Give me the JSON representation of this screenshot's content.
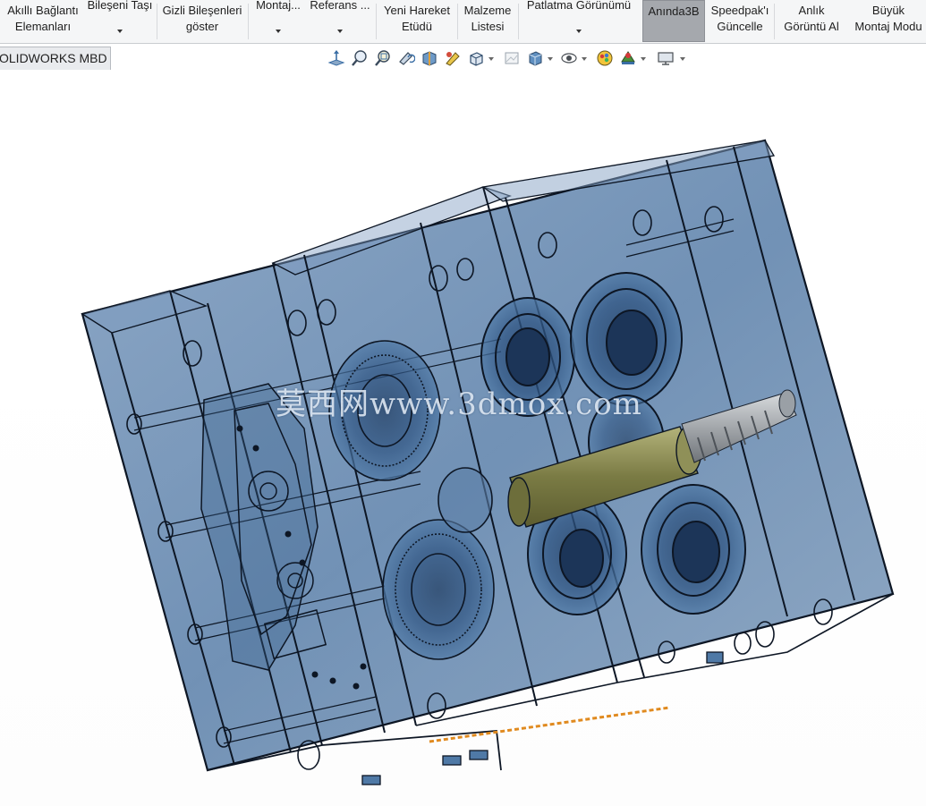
{
  "ribbon": {
    "buttons": [
      {
        "id": "smart-mates",
        "line1": "Akıllı Bağlantı",
        "line2": "Elemanları"
      },
      {
        "id": "move-component",
        "line1": "Bileşeni Taşı",
        "line2": ""
      },
      {
        "id": "show-hidden",
        "line1": "Gizli Bileşenleri",
        "line2": "göster"
      },
      {
        "id": "assembly-features",
        "line1": "Montaj...",
        "line2": ""
      },
      {
        "id": "reference",
        "line1": "Referans ...",
        "line2": ""
      },
      {
        "id": "new-motion-study",
        "line1": "Yeni Hareket",
        "line2": "Etüdü"
      },
      {
        "id": "bill-of-materials",
        "line1": "Malzeme",
        "line2": "Listesi"
      },
      {
        "id": "exploded-view",
        "line1": "Patlatma Görünümü",
        "line2": ""
      },
      {
        "id": "instant3d",
        "line1": "Anında3B",
        "line2": ""
      },
      {
        "id": "speedpak",
        "line1": "Speedpak'ı",
        "line2": "Güncelle"
      },
      {
        "id": "snapshot",
        "line1": "Anlık",
        "line2": "Görüntü Al"
      },
      {
        "id": "large-assembly",
        "line1": "Büyük",
        "line2": "Montaj Modu"
      }
    ]
  },
  "tabs": {
    "mbd_label": "OLIDWORKS MBD"
  },
  "hud_icons": [
    "view-normal-to-icon",
    "zoom-to-fit-icon",
    "zoom-to-area-icon",
    "previous-view-icon",
    "section-view-icon",
    "dynamic-annotation-icon",
    "view-orientation-icon",
    "display-style-icon",
    "hide-show-items-icon",
    "edit-appearance-icon",
    "apply-scene-icon",
    "view-settings-icon",
    "display-pane-icon"
  ],
  "graphics": {
    "watermark": "莫西网www.3dmox.com",
    "colors": {
      "housing_fill": "#4f79a6",
      "housing_edge": "#0d1624",
      "shaft": "#8a8b58",
      "hob": "#9aa0a6",
      "highlight_edge": "#e08a1f",
      "ribbon_bg": "#f5f6f7",
      "active_button": "#a5a8ad"
    }
  }
}
